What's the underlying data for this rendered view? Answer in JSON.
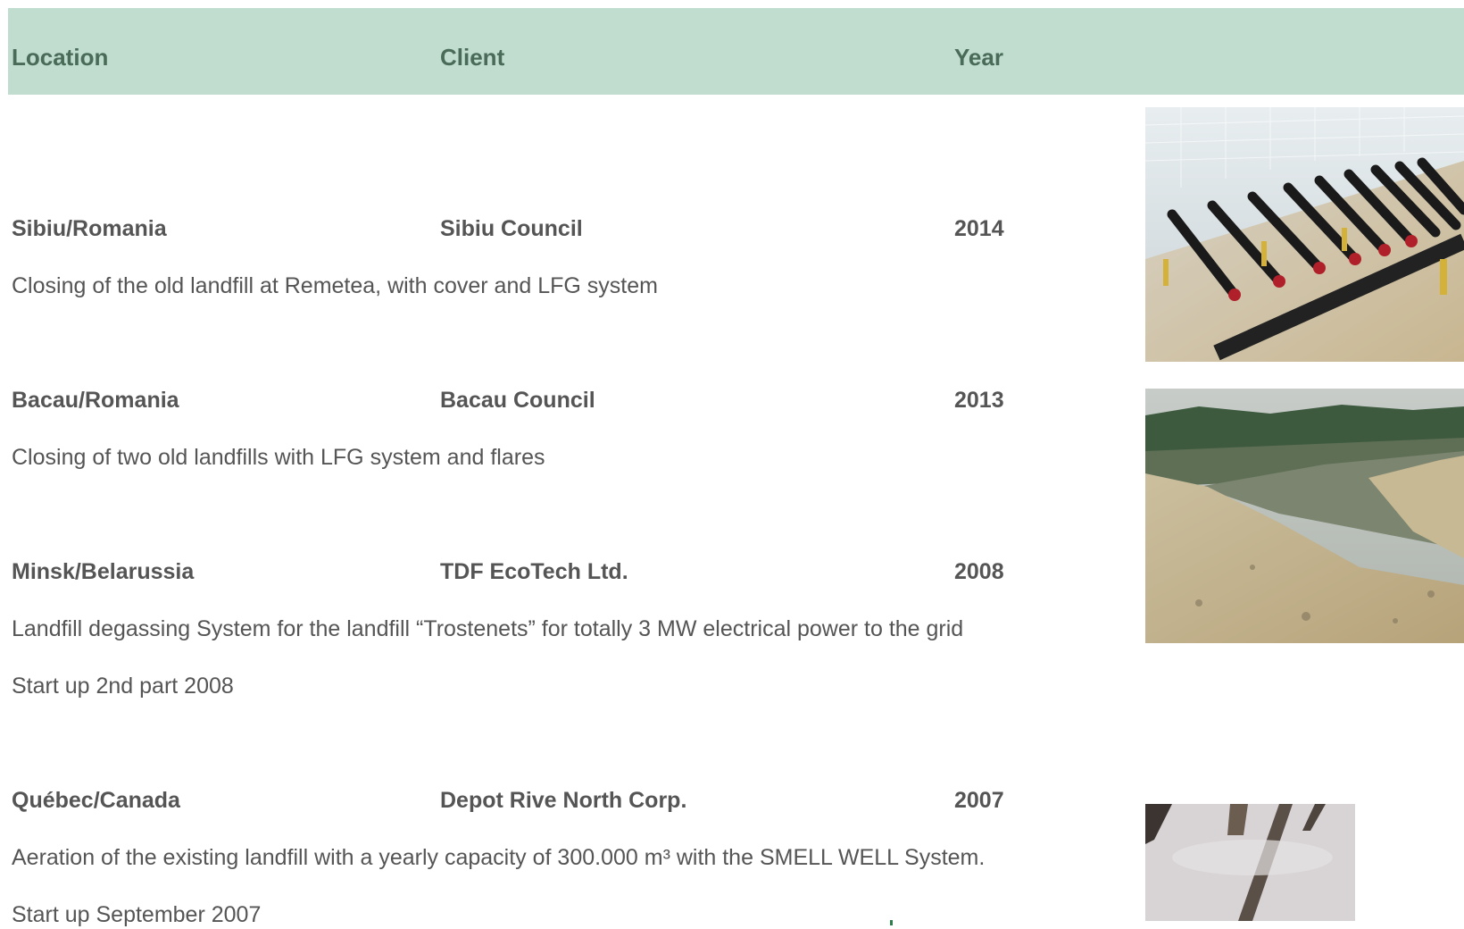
{
  "table": {
    "headers": {
      "location": "Location",
      "client": "Client",
      "year": "Year"
    },
    "projects": [
      {
        "location": "Sibiu/Romania",
        "client": "Sibiu Council",
        "year": "2014",
        "description": [
          "Closing of the old landfill at Remetea, with cover and LFG system"
        ]
      },
      {
        "location": "Bacau/Romania",
        "client": "Bacau Council",
        "year": "2013",
        "description": [
          "Closing of two old landfills with LFG system and flares"
        ]
      },
      {
        "location": "Minsk/Belarussia",
        "client": "TDF EcoTech Ltd.",
        "year": "2008",
        "description": [
          "Landfill degassing System for the landfill “Trostenets” for totally 3 MW electrical power to the grid",
          "Start up 2nd part 2008"
        ]
      },
      {
        "location": "Québec/Canada",
        "client": "Depot Rive North Corp.",
        "year": "2007",
        "description": [
          "Aeration of the existing landfill with a yearly capacity of 300.000 m³ with the SMELL WELL System.",
          "Start up September 2007"
        ]
      }
    ]
  },
  "photos": [
    {
      "name": "gas-pipe-manifold-photo"
    },
    {
      "name": "landfill-slope-photo"
    },
    {
      "name": "snow-posts-photo"
    }
  ],
  "colors": {
    "header_bg": "#c0ddd0",
    "header_text": "#4a6b58",
    "body_text": "#555555"
  }
}
